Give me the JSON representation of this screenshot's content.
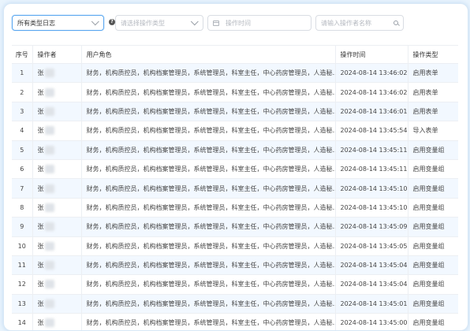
{
  "filters": {
    "log_type_selected": "所有类型日志",
    "operation_type_placeholder": "请选择操作类型",
    "operation_time_placeholder": "操作时间",
    "operator_name_placeholder": "请输入操作者名称",
    "help_glyph": "?"
  },
  "table": {
    "columns": {
      "seq": "序号",
      "operator": "操作者",
      "role": "用户角色",
      "time": "操作时间",
      "type": "操作类型"
    },
    "rows": [
      {
        "seq": "1",
        "operator": "张",
        "role": "财务，机构质控员，机构档案管理员，系统管理员，科室主任，中心药房管理员，人造秘...",
        "time": "2024-08-14 13:46:02",
        "type": "启用表单"
      },
      {
        "seq": "2",
        "operator": "张",
        "role": "财务，机构质控员，机构档案管理员，系统管理员，科室主任，中心药房管理员，人造秘...",
        "time": "2024-08-14 13:46:02",
        "type": "启用表单"
      },
      {
        "seq": "3",
        "operator": "张",
        "role": "财务，机构质控员，机构档案管理员，系统管理员，科室主任，中心药房管理员，人造秘...",
        "time": "2024-08-14 13:46:01",
        "type": "启用表单"
      },
      {
        "seq": "4",
        "operator": "张",
        "role": "财务，机构质控员，机构档案管理员，系统管理员，科室主任，中心药房管理员，人造秘...",
        "time": "2024-08-14 13:45:54",
        "type": "导入表单"
      },
      {
        "seq": "5",
        "operator": "张",
        "role": "财务，机构质控员，机构档案管理员，系统管理员，科室主任，中心药房管理员，人造秘...",
        "time": "2024-08-14 13:45:11",
        "type": "启用变量组"
      },
      {
        "seq": "6",
        "operator": "张",
        "role": "财务，机构质控员，机构档案管理员，系统管理员，科室主任，中心药房管理员，人造秘...",
        "time": "2024-08-14 13:45:11",
        "type": "启用变量组"
      },
      {
        "seq": "7",
        "operator": "张",
        "role": "财务，机构质控员，机构档案管理员，系统管理员，科室主任，中心药房管理员，人造秘...",
        "time": "2024-08-14 13:45:10",
        "type": "启用变量组"
      },
      {
        "seq": "8",
        "operator": "张",
        "role": "财务，机构质控员，机构档案管理员，系统管理员，科室主任，中心药房管理员，人造秘...",
        "time": "2024-08-14 13:45:10",
        "type": "启用变量组"
      },
      {
        "seq": "9",
        "operator": "张",
        "role": "财务，机构质控员，机构档案管理员，系统管理员，科室主任，中心药房管理员，人造秘...",
        "time": "2024-08-14 13:45:09",
        "type": "启用变量组"
      },
      {
        "seq": "10",
        "operator": "张",
        "role": "财务，机构质控员，机构档案管理员，系统管理员，科室主任，中心药房管理员，人造秘...",
        "time": "2024-08-14 13:45:05",
        "type": "启用变量组"
      },
      {
        "seq": "11",
        "operator": "张",
        "role": "财务，机构质控员，机构档案管理员，系统管理员，科室主任，中心药房管理员，人造秘...",
        "time": "2024-08-14 13:45:04",
        "type": "启用变量组"
      },
      {
        "seq": "12",
        "operator": "张",
        "role": "财务，机构质控员，机构档案管理员，系统管理员，科室主任，中心药房管理员，人造秘...",
        "time": "2024-08-14 13:45:04",
        "type": "启用变量组"
      },
      {
        "seq": "13",
        "operator": "张",
        "role": "财务，机构质控员，机构档案管理员，系统管理员，科室主任，中心药房管理员，人造秘...",
        "time": "2024-08-14 13:45:01",
        "type": "启用变量组"
      },
      {
        "seq": "14",
        "operator": "张",
        "role": "财务，机构质控员，机构档案管理员，系统管理员，科室主任，中心药房管理员，人造秘...",
        "time": "2024-08-14 13:45:00",
        "type": "启用变量组"
      }
    ]
  },
  "colors": {
    "accent": "#5aa7f0",
    "row_alt": "#f2f8ff",
    "page_bg": "#e9f4fd"
  }
}
